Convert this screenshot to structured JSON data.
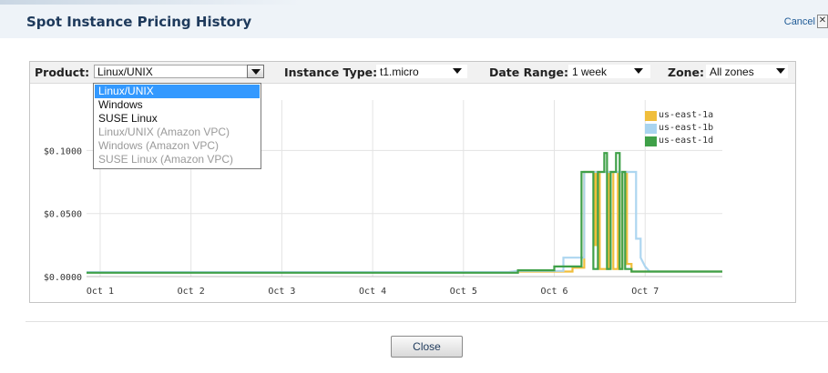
{
  "dialog": {
    "title": "Spot Instance Pricing History",
    "cancel_label": "Cancel",
    "cancel_x": "✕",
    "close_label": "Close"
  },
  "filters": {
    "product_label": "Product:",
    "product_value": "Linux/UNIX",
    "instance_type_label": "Instance Type:",
    "instance_type_value": "t1.micro",
    "date_range_label": "Date Range:",
    "date_range_value": "1 week",
    "zone_label": "Zone:",
    "zone_value": "All zones"
  },
  "product_options": [
    {
      "label": "Linux/UNIX",
      "state": "selected"
    },
    {
      "label": "Windows",
      "state": "enabled"
    },
    {
      "label": "SUSE Linux",
      "state": "enabled"
    },
    {
      "label": "Linux/UNIX (Amazon VPC)",
      "state": "disabled"
    },
    {
      "label": "Windows (Amazon VPC)",
      "state": "disabled"
    },
    {
      "label": "SUSE Linux (Amazon VPC)",
      "state": "disabled"
    }
  ],
  "colors": {
    "us-east-1a": "#f0be3c",
    "us-east-1b": "#a9d4ef",
    "us-east-1d": "#3fa048",
    "selected_option": "#3399ff"
  },
  "chart_data": {
    "type": "line",
    "title": "",
    "xlabel": "",
    "ylabel": "",
    "x_ticks": [
      "Oct 1",
      "Oct 2",
      "Oct 3",
      "Oct 4",
      "Oct 5",
      "Oct 6",
      "Oct 7"
    ],
    "y_ticks": [
      "$0.0000",
      "$0.0500",
      "$0.1000"
    ],
    "y_tick_values": [
      0,
      0.05,
      0.1
    ],
    "xlim": [
      0.85,
      7.85
    ],
    "ylim": [
      0,
      0.14
    ],
    "grid": true,
    "legend_position": "top-right",
    "series": [
      {
        "name": "us-east-1a",
        "x": [
          0.85,
          5.5,
          5.6,
          6.2,
          6.2,
          6.3,
          6.33,
          6.33,
          6.45,
          6.45,
          6.47,
          6.47,
          6.5,
          6.5,
          6.6,
          6.6,
          6.65,
          6.65,
          6.7,
          6.7,
          6.72,
          6.72,
          6.75,
          6.75,
          6.8,
          6.8,
          6.85,
          6.85,
          7.85
        ],
        "y": [
          0.0035,
          0.0035,
          0.004,
          0.004,
          0.007,
          0.007,
          0.007,
          0.083,
          0.083,
          0.025,
          0.025,
          0.083,
          0.083,
          0.006,
          0.006,
          0.083,
          0.083,
          0.006,
          0.006,
          0.083,
          0.083,
          0.006,
          0.006,
          0.083,
          0.083,
          0.01,
          0.01,
          0.004,
          0.004
        ]
      },
      {
        "name": "us-east-1b",
        "x": [
          0.85,
          5.5,
          5.6,
          6.1,
          6.1,
          6.3,
          6.33,
          6.33,
          6.9,
          6.9,
          6.95,
          6.95,
          7.0,
          7.05,
          7.85
        ],
        "y": [
          0.0035,
          0.0035,
          0.0045,
          0.0045,
          0.015,
          0.015,
          0.015,
          0.083,
          0.083,
          0.03,
          0.03,
          0.015,
          0.008,
          0.004,
          0.004
        ]
      },
      {
        "name": "us-east-1d",
        "x": [
          0.85,
          5.6,
          5.6,
          6.0,
          6.0,
          6.3,
          6.3,
          6.33,
          6.33,
          6.43,
          6.43,
          6.48,
          6.48,
          6.55,
          6.55,
          6.58,
          6.58,
          6.62,
          6.62,
          6.68,
          6.68,
          6.72,
          6.72,
          6.75,
          6.75,
          6.78,
          6.78,
          6.85,
          6.85,
          7.85
        ],
        "y": [
          0.003,
          0.003,
          0.005,
          0.005,
          0.008,
          0.008,
          0.083,
          0.083,
          0.083,
          0.083,
          0.006,
          0.006,
          0.083,
          0.083,
          0.098,
          0.098,
          0.006,
          0.006,
          0.083,
          0.083,
          0.098,
          0.098,
          0.006,
          0.006,
          0.083,
          0.083,
          0.006,
          0.006,
          0.004,
          0.004
        ]
      }
    ]
  }
}
